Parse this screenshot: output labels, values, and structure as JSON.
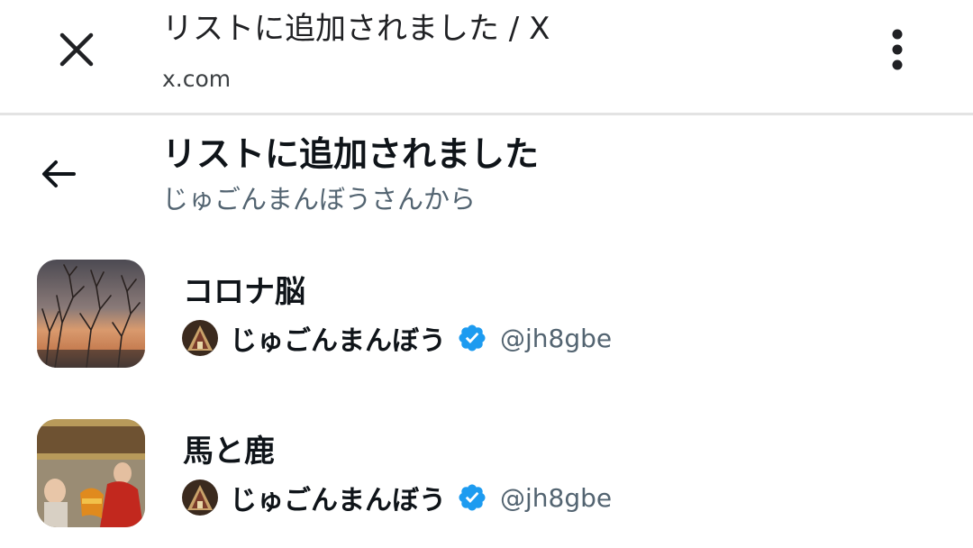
{
  "browser": {
    "tab_title": "リストに追加されました / X",
    "url": "x.com",
    "close_icon": "close-icon",
    "menu_icon": "more-vertical-icon"
  },
  "header": {
    "back_icon": "arrow-left-icon",
    "title": "リストに追加されました",
    "subtitle": "じゅごんまんぼうさんから"
  },
  "lists": [
    {
      "name": "コロナ脳",
      "owner_name": "じゅごんまんぼう",
      "owner_handle": "@jh8gbe",
      "verified": true
    },
    {
      "name": "馬と鹿",
      "owner_name": "じゅごんまんぼう",
      "owner_handle": "@jh8gbe",
      "verified": true
    }
  ],
  "colors": {
    "verified_badge": "#1d9bf0",
    "secondary_text": "#536471"
  }
}
